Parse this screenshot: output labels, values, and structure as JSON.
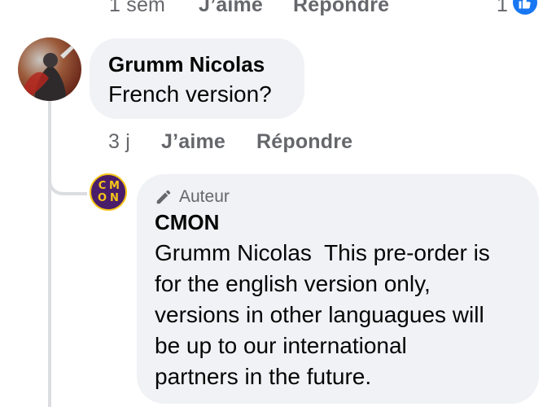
{
  "top_row": {
    "time": "1 sem",
    "like": "J’aime",
    "reply": "Répondre",
    "reaction_count": "1"
  },
  "comment": {
    "author": "Grumm Nicolas",
    "text": "French version?",
    "time": "3 j",
    "like": "J’aime",
    "reply": "Répondre"
  },
  "reply": {
    "badge": "Auteur",
    "author": "CMON",
    "avatar_letters": [
      "C",
      "M",
      "O",
      "N"
    ],
    "lines": [
      "Grumm Nicolas  This pre-order is",
      "for the english version only,",
      "versions in other languagues will",
      "be up to our international",
      "partners in the future."
    ]
  },
  "colors": {
    "bubble": "#f0f2f5",
    "secondary_text": "#65676b",
    "like_blue": "#1877f2",
    "cmon_purple": "#4a1d6a",
    "cmon_yellow": "#f5c518"
  },
  "icons": {
    "like": "thumbs-up-icon",
    "badge": "pencil-icon"
  }
}
